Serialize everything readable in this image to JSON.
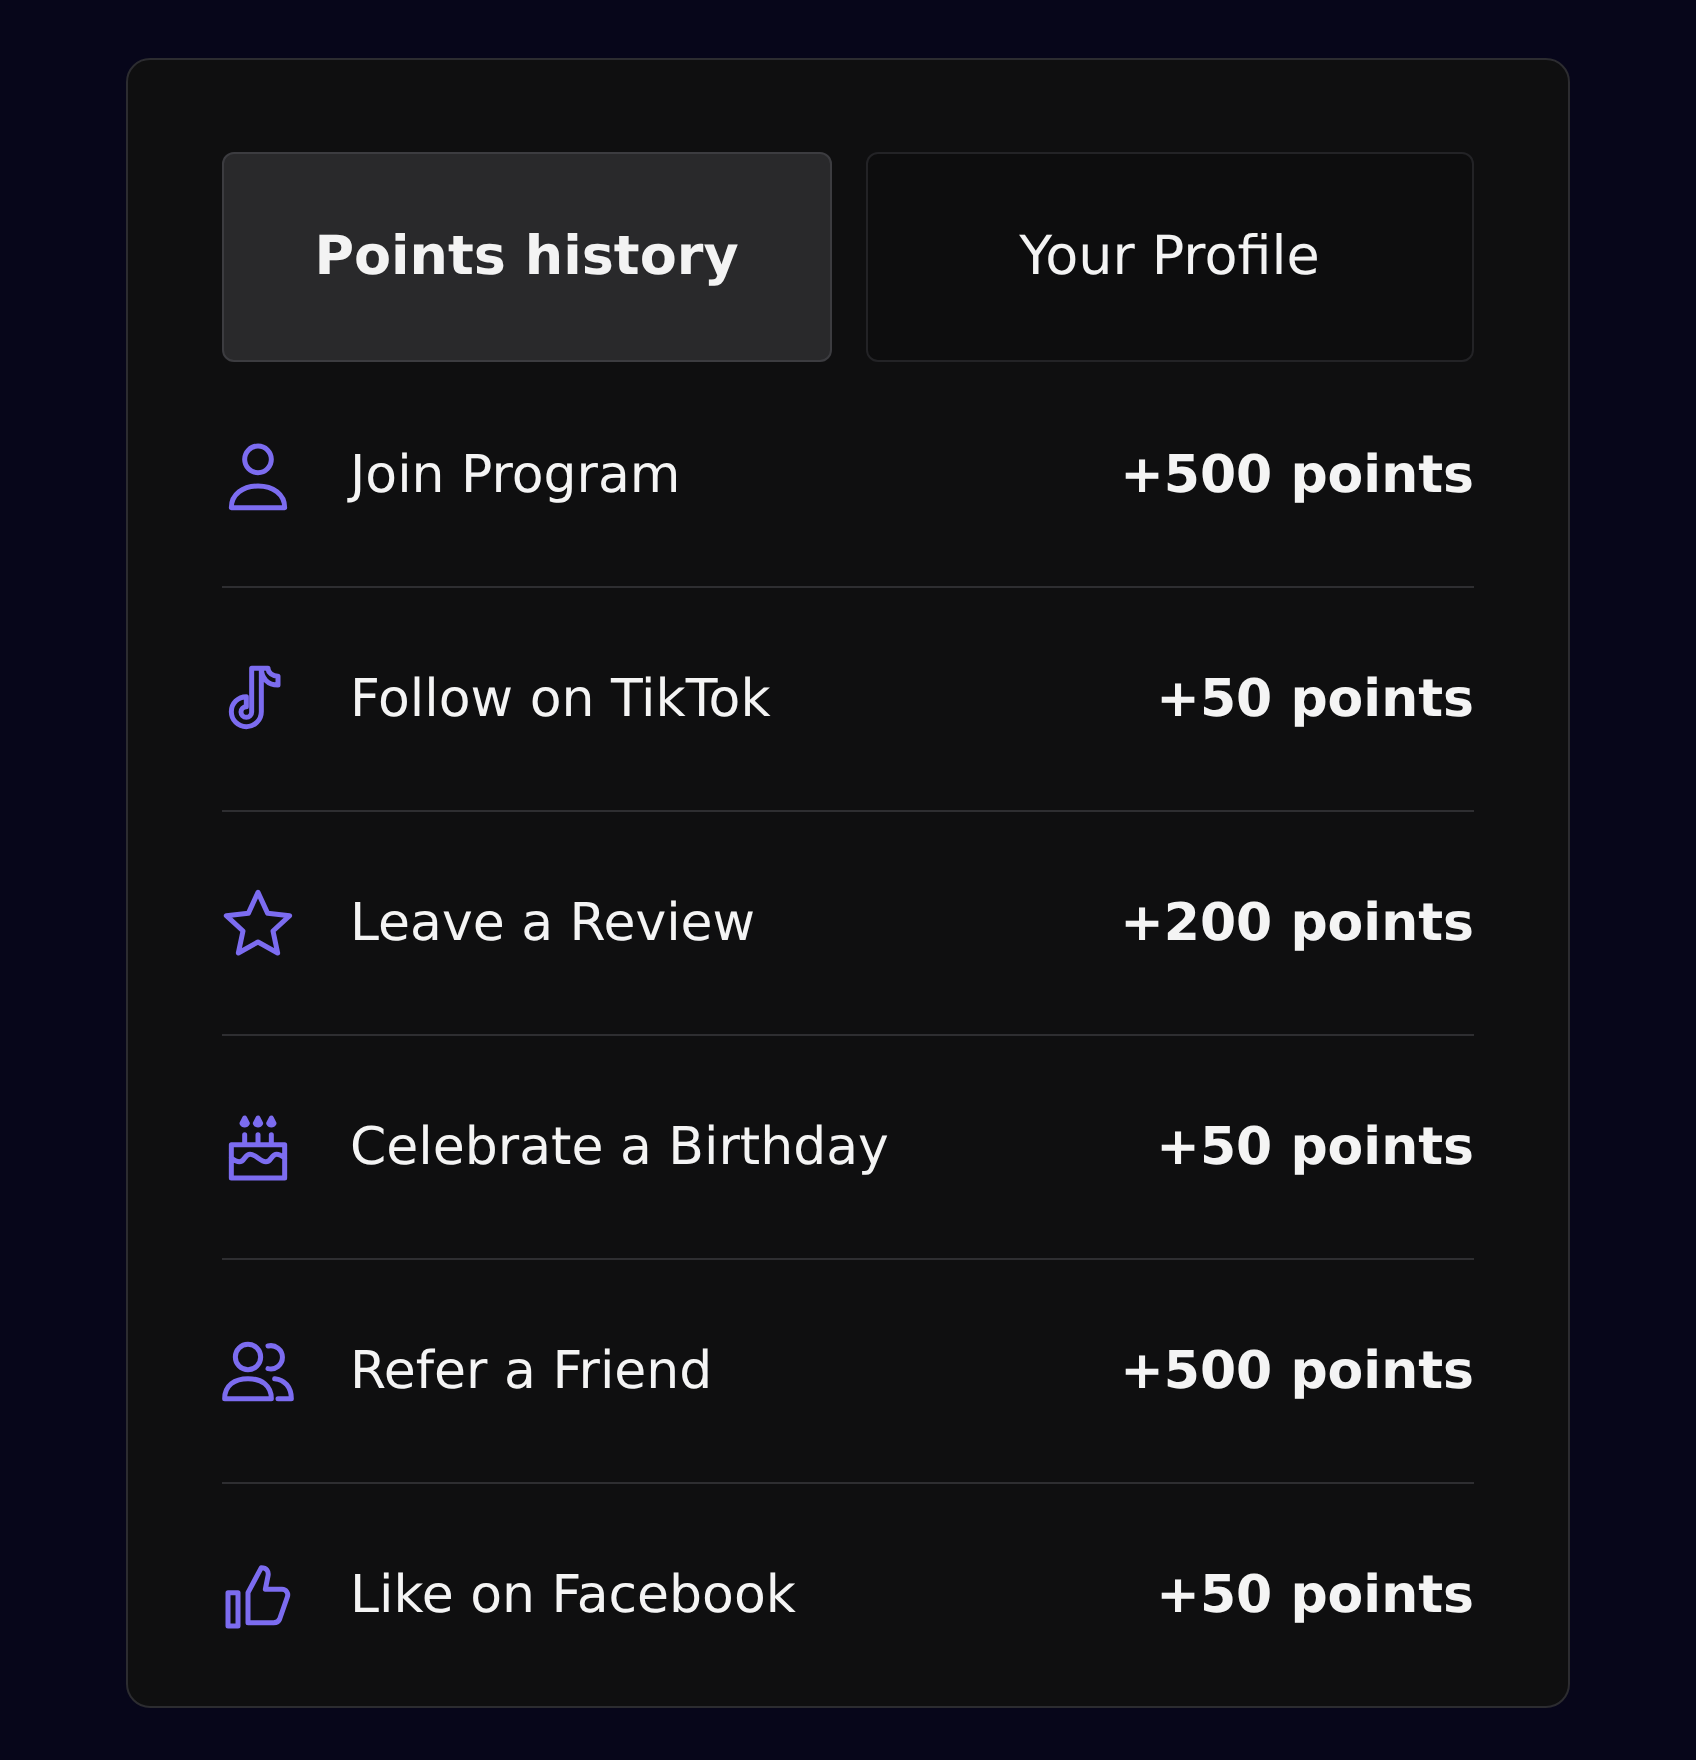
{
  "tabs": [
    {
      "label": "Points history",
      "selected": true
    },
    {
      "label": "Your Profile",
      "selected": false
    }
  ],
  "rows": [
    {
      "kind": "user",
      "label": "Join Program",
      "points": "+500 points"
    },
    {
      "kind": "music",
      "label": "Follow on TikTok",
      "points": "+50 points"
    },
    {
      "kind": "star",
      "label": "Leave a Review",
      "points": "+200 points"
    },
    {
      "kind": "cake",
      "label": "Celebrate a Birthday",
      "points": "+50 points"
    },
    {
      "kind": "users",
      "label": "Refer a Friend",
      "points": "+500 points"
    },
    {
      "kind": "thumb",
      "label": "Like on Facebook",
      "points": "+50 points"
    }
  ]
}
